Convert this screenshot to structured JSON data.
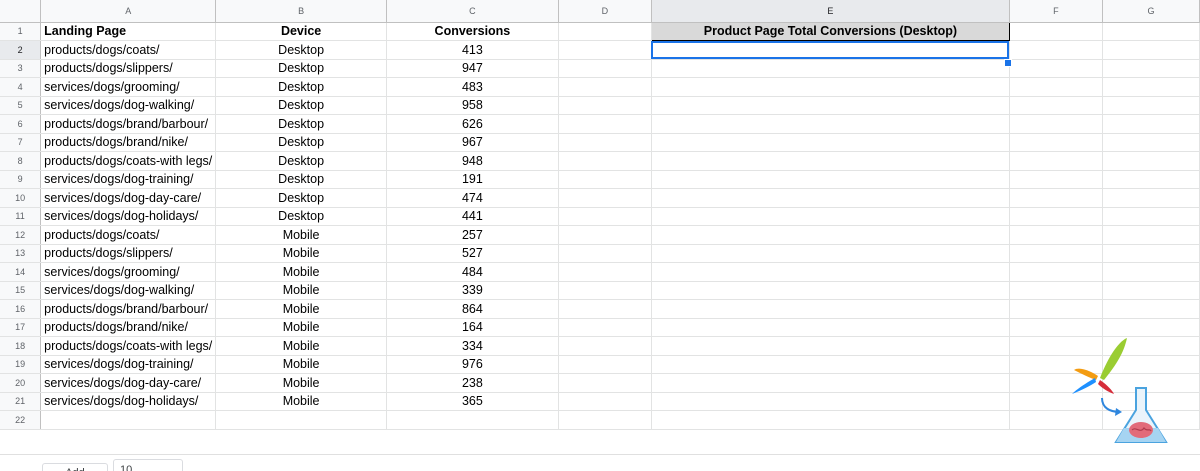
{
  "columns": [
    "A",
    "B",
    "C",
    "D",
    "E",
    "F",
    "G"
  ],
  "headers": {
    "landing_page": "Landing Page",
    "device": "Device",
    "conversions": "Conversions",
    "e1": "Product Page Total Conversions (Desktop)"
  },
  "rows": [
    {
      "num": "1"
    },
    {
      "num": "2",
      "page": "products/dogs/coats/",
      "device": "Desktop",
      "conv": "413"
    },
    {
      "num": "3",
      "page": "products/dogs/slippers/",
      "device": "Desktop",
      "conv": "947"
    },
    {
      "num": "4",
      "page": "services/dogs/grooming/",
      "device": "Desktop",
      "conv": "483"
    },
    {
      "num": "5",
      "page": "services/dogs/dog-walking/",
      "device": "Desktop",
      "conv": "958"
    },
    {
      "num": "6",
      "page": "products/dogs/brand/barbour/",
      "device": "Desktop",
      "conv": "626"
    },
    {
      "num": "7",
      "page": "products/dogs/brand/nike/",
      "device": "Desktop",
      "conv": "967"
    },
    {
      "num": "8",
      "page": "products/dogs/coats-with legs/",
      "device": "Desktop",
      "conv": "948"
    },
    {
      "num": "9",
      "page": "services/dogs/dog-training/",
      "device": "Desktop",
      "conv": "191"
    },
    {
      "num": "10",
      "page": "services/dogs/dog-day-care/",
      "device": "Desktop",
      "conv": "474"
    },
    {
      "num": "11",
      "page": "services/dogs/dog-holidays/",
      "device": "Desktop",
      "conv": "441"
    },
    {
      "num": "12",
      "page": "products/dogs/coats/",
      "device": "Mobile",
      "conv": "257"
    },
    {
      "num": "13",
      "page": "products/dogs/slippers/",
      "device": "Mobile",
      "conv": "527"
    },
    {
      "num": "14",
      "page": "services/dogs/grooming/",
      "device": "Mobile",
      "conv": "484"
    },
    {
      "num": "15",
      "page": "services/dogs/dog-walking/",
      "device": "Mobile",
      "conv": "339"
    },
    {
      "num": "16",
      "page": "products/dogs/brand/barbour/",
      "device": "Mobile",
      "conv": "864"
    },
    {
      "num": "17",
      "page": "products/dogs/brand/nike/",
      "device": "Mobile",
      "conv": "164"
    },
    {
      "num": "18",
      "page": "products/dogs/coats-with legs/",
      "device": "Mobile",
      "conv": "334"
    },
    {
      "num": "19",
      "page": "services/dogs/dog-training/",
      "device": "Mobile",
      "conv": "976"
    },
    {
      "num": "20",
      "page": "services/dogs/dog-day-care/",
      "device": "Mobile",
      "conv": "238"
    },
    {
      "num": "21",
      "page": "services/dogs/dog-holidays/",
      "device": "Mobile",
      "conv": "365"
    },
    {
      "num": "22"
    }
  ],
  "bottom": {
    "add_label": "Add",
    "rows_value": "10"
  },
  "colors": {
    "header_fill": "#d9d9d9",
    "selection": "#1a73e8"
  },
  "logo": {
    "icon": "flask-brain-logo-icon"
  }
}
